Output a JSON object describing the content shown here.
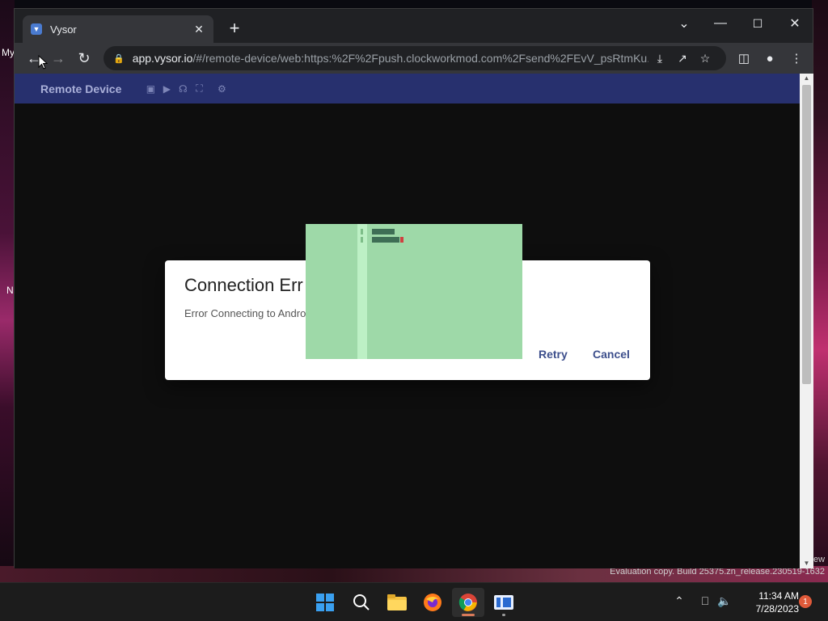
{
  "desktop": {
    "labels": [
      "My",
      "N"
    ],
    "watermark": "Evaluation copy. Build 25375.zn_release.230519-1632",
    "side_text": "ew"
  },
  "browser": {
    "tab": {
      "title": "Vysor",
      "favicon": "vysor-icon"
    },
    "url": {
      "host": "app.vysor.io",
      "path": "/#/remote-device/web:https:%2F%2Fpush.clockworkmod.com%2Fsend%2FEvV_psRtmKu..."
    },
    "window_controls": [
      "minimize-icon",
      "maximize-icon",
      "close-icon"
    ]
  },
  "app": {
    "header_title": "Remote Device",
    "header_icons": [
      "camera-icon",
      "video-icon",
      "headphones-icon",
      "fullscreen-icon",
      "gear-icon"
    ]
  },
  "dialog": {
    "title": "Connection Err",
    "body": "Error Connecting to Andro",
    "retry_label": "Retry",
    "cancel_label": "Cancel"
  },
  "taskbar": {
    "time": "11:34 AM",
    "date": "7/28/2023",
    "notification_count": "1",
    "apps": [
      "start-icon",
      "search-icon",
      "file-explorer-icon",
      "firefox-icon",
      "chrome-icon",
      "vysor-app-icon"
    ]
  },
  "colors": {
    "app_header": "#27306e",
    "dialog_button": "#3d4f8c",
    "overlay_green": "#9ed9a8"
  }
}
